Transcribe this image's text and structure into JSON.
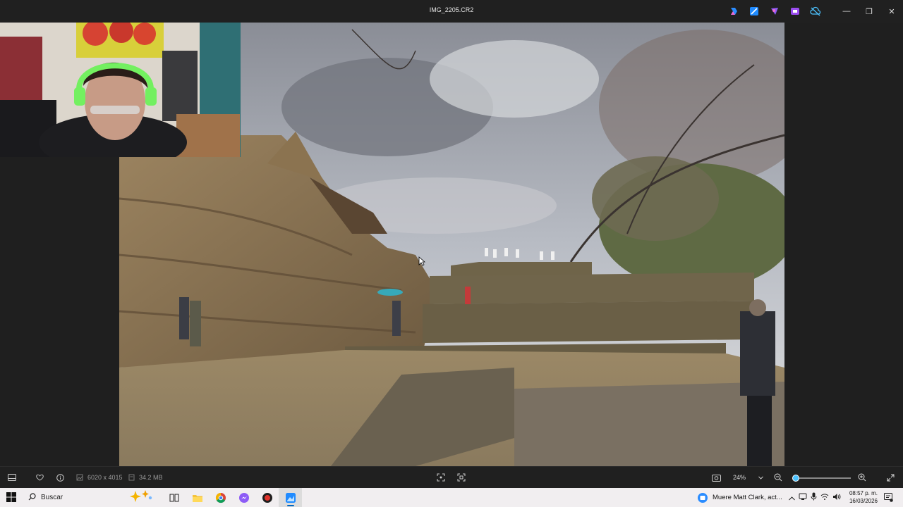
{
  "window": {
    "title": "IMG_2205.CR2",
    "controls": {
      "minimize": "—",
      "restore": "❐",
      "close": "✕"
    }
  },
  "image_info": {
    "dimensions": "6020 x 4015",
    "file_size": "34.2 MB"
  },
  "zoom": {
    "level": "24%",
    "slider_fraction": 0.04
  },
  "taskbar": {
    "search_label": "Buscar",
    "news_text": "Muere Matt Clark, act...",
    "time": "08:57 p. m.",
    "date": "16/03/2026"
  },
  "colors": {
    "accent": "#4cc2ff",
    "taskbar_bg": "#f1eef0",
    "app_bg": "#202020"
  }
}
